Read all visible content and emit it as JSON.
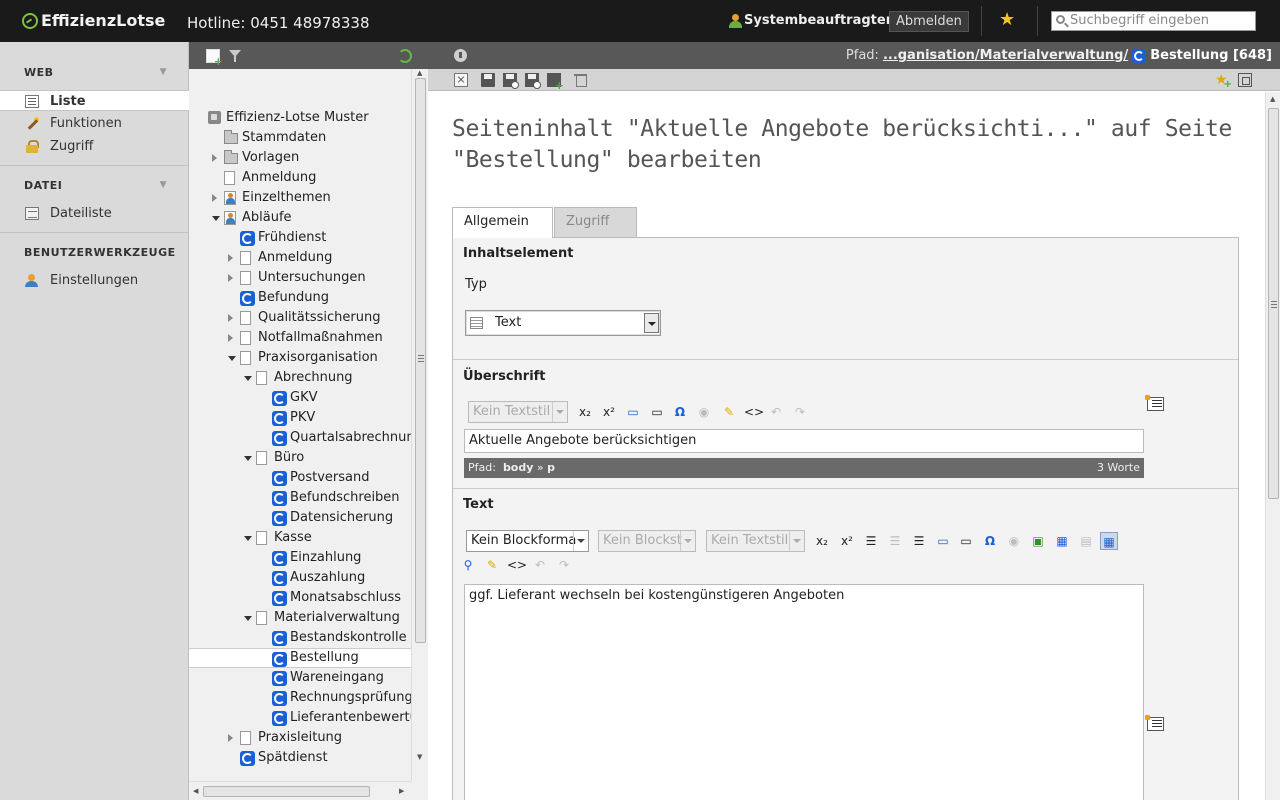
{
  "header": {
    "logo": "EffizienzLotse",
    "hotline": "Hotline: 0451 48978338",
    "user": "Systembeauftragter",
    "logout": "Abmelden",
    "search_placeholder": "Suchbegriff eingeben"
  },
  "modules": {
    "groups": [
      {
        "label": "WEB"
      },
      {
        "label": "DATEI"
      },
      {
        "label": "BENUTZERWERKZEUGE"
      }
    ],
    "items": [
      {
        "label": "Liste",
        "icon": "list-icon"
      },
      {
        "label": "Funktionen",
        "icon": "wand-icon"
      },
      {
        "label": "Zugriff",
        "icon": "lock-icon"
      },
      {
        "label": "Dateiliste",
        "icon": "file-list-icon"
      },
      {
        "label": "Einstellungen",
        "icon": "user-settings-icon"
      }
    ]
  },
  "tree": {
    "nodes": [
      {
        "label": "Effizienz-Lotse Muster",
        "icon": "root-icon",
        "expander": "none"
      },
      {
        "label": "Stammdaten",
        "icon": "folder-icon",
        "expander": "none"
      },
      {
        "label": "Vorlagen",
        "icon": "folder-icon",
        "expander": "closed"
      },
      {
        "label": "Anmeldung",
        "icon": "page-icon",
        "expander": "none"
      },
      {
        "label": "Einzelthemen",
        "icon": "user-page-icon",
        "expander": "closed"
      },
      {
        "label": "Abläufe",
        "icon": "user-page-icon",
        "expander": "open"
      },
      {
        "label": "Frühdienst",
        "icon": "shortcut-icon",
        "expander": "none"
      },
      {
        "label": "Anmeldung",
        "icon": "page-icon",
        "expander": "closed"
      },
      {
        "label": "Untersuchungen",
        "icon": "page-icon",
        "expander": "closed"
      },
      {
        "label": "Befundung",
        "icon": "shortcut-icon",
        "expander": "none"
      },
      {
        "label": "Qualitätssicherung",
        "icon": "page-icon",
        "expander": "closed"
      },
      {
        "label": "Notfallmaßnahmen",
        "icon": "page-icon",
        "expander": "closed"
      },
      {
        "label": "Praxisorganisation",
        "icon": "page-icon",
        "expander": "open"
      },
      {
        "label": "Abrechnung",
        "icon": "page-icon",
        "expander": "open"
      },
      {
        "label": "GKV",
        "icon": "shortcut-icon",
        "expander": "none"
      },
      {
        "label": "PKV",
        "icon": "shortcut-icon",
        "expander": "none"
      },
      {
        "label": "Quartalsabrechnun",
        "icon": "shortcut-icon",
        "expander": "none"
      },
      {
        "label": "Büro",
        "icon": "page-icon",
        "expander": "open"
      },
      {
        "label": "Postversand",
        "icon": "shortcut-icon",
        "expander": "none"
      },
      {
        "label": "Befundschreiben",
        "icon": "shortcut-icon",
        "expander": "none"
      },
      {
        "label": "Datensicherung",
        "icon": "shortcut-icon",
        "expander": "none"
      },
      {
        "label": "Kasse",
        "icon": "page-icon",
        "expander": "open"
      },
      {
        "label": "Einzahlung",
        "icon": "shortcut-icon",
        "expander": "none"
      },
      {
        "label": "Auszahlung",
        "icon": "shortcut-icon",
        "expander": "none"
      },
      {
        "label": "Monatsabschluss",
        "icon": "shortcut-icon",
        "expander": "none"
      },
      {
        "label": "Materialverwaltung",
        "icon": "page-icon",
        "expander": "open"
      },
      {
        "label": "Bestandskontrolle",
        "icon": "shortcut-icon",
        "expander": "none"
      },
      {
        "label": "Bestellung",
        "icon": "shortcut-icon",
        "expander": "none",
        "selected": true
      },
      {
        "label": "Wareneingang",
        "icon": "shortcut-icon",
        "expander": "none"
      },
      {
        "label": "Rechnungsprüfung",
        "icon": "shortcut-icon",
        "expander": "none"
      },
      {
        "label": "Lieferantenbewertu",
        "icon": "shortcut-icon",
        "expander": "none"
      },
      {
        "label": "Praxisleitung",
        "icon": "page-icon",
        "expander": "closed"
      },
      {
        "label": "Spätdienst",
        "icon": "shortcut-icon",
        "expander": "none"
      }
    ]
  },
  "pathbar": {
    "prefix": "Pfad:",
    "path": "...ganisation/Materialverwaltung/",
    "page": "Bestellung [648]"
  },
  "content": {
    "title": "Seiteninhalt \"Aktuelle Angebote berücksichti...\" auf Seite \"Bestellung\" bearbeiten",
    "tabs": [
      {
        "label": "Allgemein",
        "active": true
      },
      {
        "label": "Zugriff",
        "active": false
      }
    ],
    "element_section": "Inhaltselement",
    "type_label": "Typ",
    "type_value": "Text",
    "heading_section": "Überschrift",
    "heading_toolbar": {
      "style_select": "Kein Textstil"
    },
    "heading_value": "Aktuelle Angebote berücksichtigen",
    "heading_status": {
      "prefix": "Pfad:",
      "body": "body",
      "sep": "»",
      "p": "p",
      "words": "3 Worte"
    },
    "text_section": "Text",
    "text_toolbar": {
      "block_format": "Kein Blockforma",
      "block_style": "Kein Blockst",
      "text_style": "Kein Textstil"
    },
    "text_value": "ggf. Lieferant wechseln bei kostengünstigeren Angeboten"
  }
}
